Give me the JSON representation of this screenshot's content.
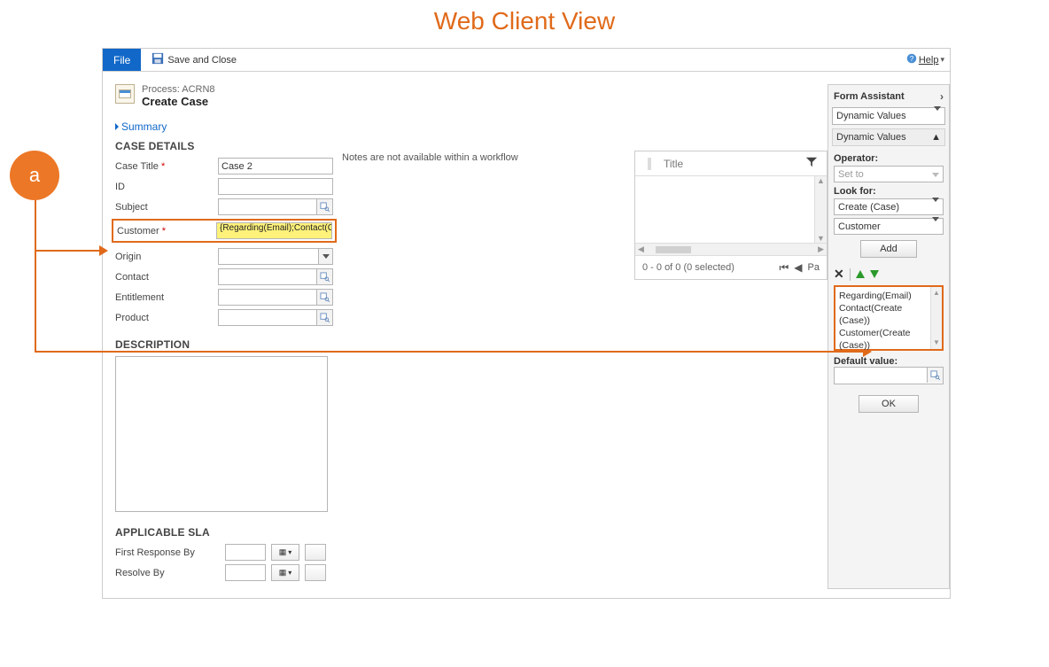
{
  "pageTitle": "Web Client View",
  "toolbar": {
    "fileLabel": "File",
    "saveCloseLabel": "Save and Close",
    "helpLabel": "Help"
  },
  "process": {
    "prefix": "Process: ACRN8",
    "title": "Create Case"
  },
  "summaryLabel": "Summary",
  "caseDetails": {
    "heading": "CASE DETAILS",
    "fields": {
      "caseTitleLabel": "Case Title",
      "caseTitleValue": "Case 2",
      "idLabel": "ID",
      "subjectLabel": "Subject",
      "customerLabel": "Customer",
      "customerValue": "{Regarding(Email);Contact(Cre",
      "originLabel": "Origin",
      "contactLabel": "Contact",
      "entitlementLabel": "Entitlement",
      "productLabel": "Product"
    }
  },
  "notesMessage": "Notes are not available within a workflow",
  "grid": {
    "columnTitle": "Title",
    "footer": "0 - 0 of 0 (0 selected)",
    "pageLabel": "Pa"
  },
  "description": {
    "heading": "DESCRIPTION"
  },
  "sla": {
    "heading": "APPLICABLE SLA",
    "firstResponseLabel": "First Response By",
    "resolveByLabel": "Resolve By"
  },
  "assistant": {
    "title": "Form Assistant",
    "topSelect": "Dynamic Values",
    "sectionLabel": "Dynamic Values",
    "operatorLabel": "Operator:",
    "operatorValue": "Set to",
    "lookForLabel": "Look for:",
    "lookFor1": "Create (Case)",
    "lookFor2": "Customer",
    "addLabel": "Add",
    "valuesList": [
      "Regarding(Email)",
      "Contact(Create (Case))",
      "Customer(Create (Case))"
    ],
    "defaultValueLabel": "Default value:",
    "okLabel": "OK"
  },
  "annotation": {
    "badge": "a"
  }
}
